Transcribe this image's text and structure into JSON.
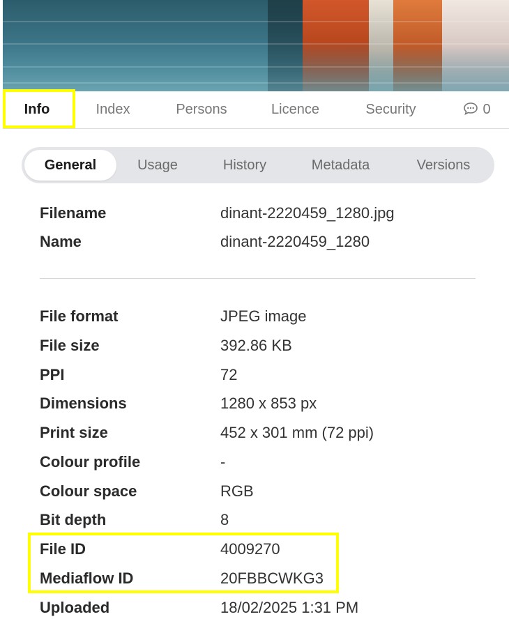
{
  "tabs": [
    {
      "label": "Info",
      "active": true
    },
    {
      "label": "Index",
      "active": false
    },
    {
      "label": "Persons",
      "active": false
    },
    {
      "label": "Licence",
      "active": false
    },
    {
      "label": "Security",
      "active": false
    }
  ],
  "comments": {
    "count": "0",
    "icon": "comment-icon"
  },
  "subtabs": [
    {
      "label": "General",
      "active": true
    },
    {
      "label": "Usage",
      "active": false
    },
    {
      "label": "History",
      "active": false
    },
    {
      "label": "Metadata",
      "active": false
    },
    {
      "label": "Versions",
      "active": false
    }
  ],
  "file_info": {
    "filename": {
      "key": "Filename",
      "value": "dinant-2220459_1280.jpg"
    },
    "name": {
      "key": "Name",
      "value": "dinant-2220459_1280"
    }
  },
  "properties": [
    {
      "key": "File format",
      "value": "JPEG image"
    },
    {
      "key": "File size",
      "value": "392.86 KB"
    },
    {
      "key": "PPI",
      "value": "72"
    },
    {
      "key": "Dimensions",
      "value": "1280 x 853 px"
    },
    {
      "key": "Print size",
      "value": "452 x 301 mm (72 ppi)"
    },
    {
      "key": "Colour profile",
      "value": "-"
    },
    {
      "key": "Colour space",
      "value": "RGB"
    },
    {
      "key": "Bit depth",
      "value": "8"
    },
    {
      "key": "File ID",
      "value": "4009270"
    },
    {
      "key": "Mediaflow ID",
      "value": "20FBBCWKG3"
    },
    {
      "key": "Uploaded",
      "value": "18/02/2025 1:31 PM"
    }
  ],
  "colors": {
    "highlight": "#ffff00",
    "subtab_bg": "#e4e5e8"
  }
}
